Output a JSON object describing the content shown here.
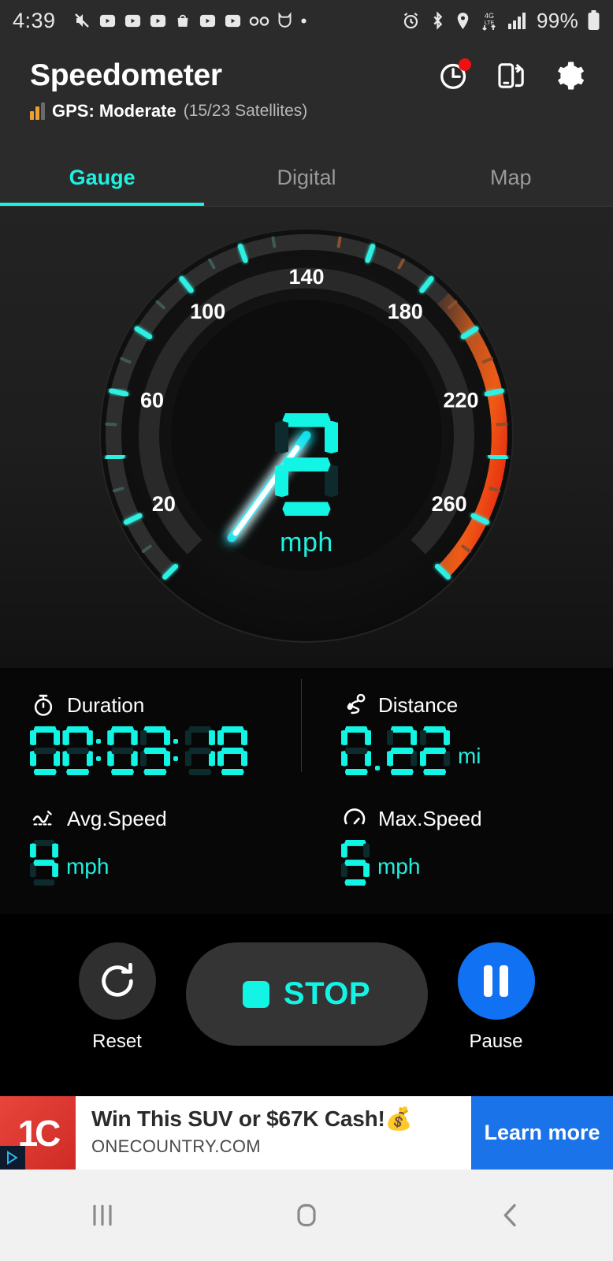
{
  "statusbar": {
    "time": "4:39",
    "left_icons": [
      "mute-icon",
      "video-icon",
      "video-icon",
      "video-icon",
      "bag-icon",
      "video-icon",
      "video-icon",
      "voicemail-icon",
      "cat-icon",
      "dot-icon"
    ],
    "right_icons": [
      "alarm-icon",
      "bluetooth-icon",
      "location-icon",
      "lte-data-icon",
      "signal-icon"
    ],
    "battery_percent": "99%"
  },
  "header": {
    "title": "Speedometer",
    "icons": [
      "history-clock-icon",
      "screen-rotate-icon",
      "gear-icon"
    ],
    "gps_label": "GPS: Moderate",
    "gps_satellites": "(15/23 Satellites)",
    "gps_bars_active": 2,
    "gps_bars_total": 3,
    "badge_color": "#ee1111"
  },
  "tabs": [
    {
      "label": "Gauge",
      "active": true
    },
    {
      "label": "Digital",
      "active": false
    },
    {
      "label": "Map",
      "active": false
    }
  ],
  "gauge": {
    "value": "2",
    "unit": "mph",
    "min": 0,
    "max": 280,
    "needle_value": 5,
    "tick_labels": [
      "20",
      "60",
      "100",
      "140",
      "180",
      "220",
      "260"
    ],
    "accent_color": "#12f5e4",
    "warn_color": "#ef5b16",
    "danger_color": "#e41b0e"
  },
  "stats": [
    {
      "icon": "stopwatch-icon",
      "label": "Duration",
      "value": "00:03:18",
      "unit": ""
    },
    {
      "icon": "route-icon",
      "label": "Distance",
      "value": "0.22",
      "unit": "mi"
    },
    {
      "icon": "avg-speed-icon",
      "label": "Avg.Speed",
      "value": "4",
      "unit": "mph"
    },
    {
      "icon": "max-speed-icon",
      "label": "Max.Speed",
      "value": "5",
      "unit": "mph"
    }
  ],
  "controls": {
    "reset_label": "Reset",
    "stop_label": "STOP",
    "pause_label": "Pause",
    "pause_color": "#1072f3"
  },
  "ad": {
    "logo_text": "1C",
    "title": "Win This SUV or $67K Cash!💰",
    "url": "ONECOUNTRY.COM",
    "cta": "Learn more"
  },
  "navbar": {
    "recents": "recents-icon",
    "home": "home-icon",
    "back": "back-icon"
  }
}
